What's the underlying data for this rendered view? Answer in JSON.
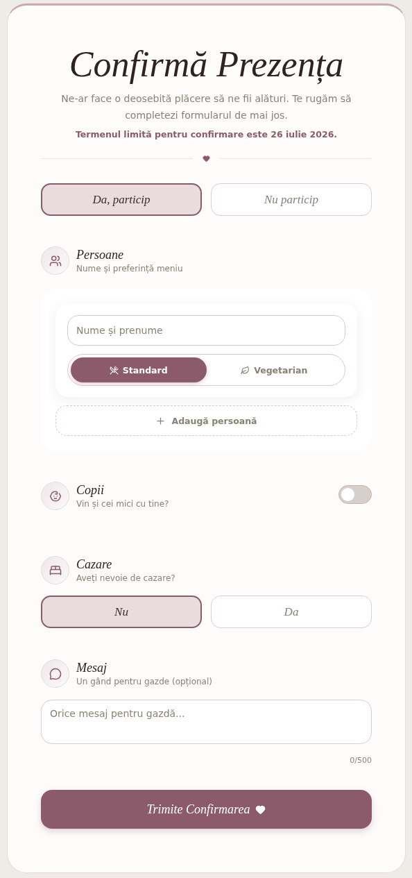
{
  "header": {
    "title": "Confirmă Prezența",
    "subtitle": "Ne-ar face o deosebită plăcere să ne fii alături. Te rugăm să completezi formularul de mai jos.",
    "deadline": "Termenul limită pentru confirmare este 26 iulie 2026."
  },
  "attendance": [
    {
      "label": "Da, particip",
      "selected": true
    },
    {
      "label": "Nu particip",
      "selected": false
    }
  ],
  "persons": {
    "title": "Persoane",
    "subtitle": "Nume și preferință meniu",
    "guests": [
      {
        "placeholder": "Nume și prenume",
        "meals": [
          {
            "kind": "standard",
            "label": "Standard",
            "selected": true
          },
          {
            "kind": "vegetarian",
            "label": "Vegetarian",
            "selected": false
          }
        ]
      }
    ],
    "add_button": "Adaugă persoană"
  },
  "children": {
    "title": "Copii",
    "subtitle": "Vin și cei mici cu tine?",
    "on": false
  },
  "accommodation": {
    "title": "Cazare",
    "subtitle": "Aveți nevoie de cazare?",
    "options": [
      {
        "label": "Nu",
        "selected": true
      },
      {
        "label": "Da",
        "selected": false
      }
    ]
  },
  "message": {
    "title": "Mesaj",
    "subtitle": "Un gând pentru gazde (opțional)",
    "placeholder": "Orice mesaj pentru gazdă...",
    "counter": "0/500"
  },
  "submit": {
    "label": "Trimite Confirmarea"
  }
}
